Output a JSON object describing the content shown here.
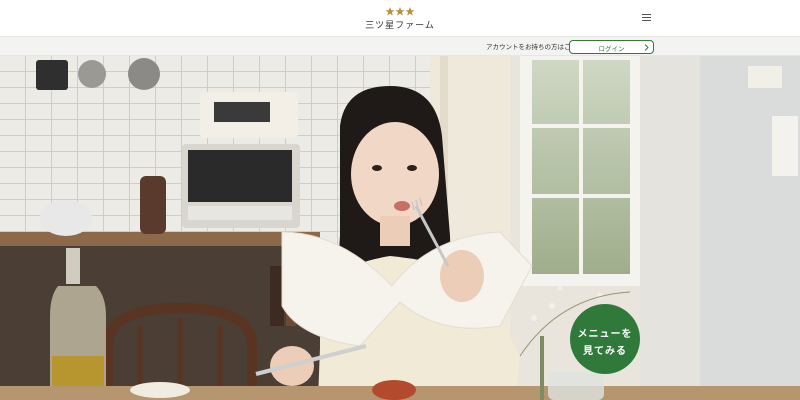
{
  "header": {
    "logo_text": "三ツ星ファーム",
    "logo_icon": "three-stars-icon",
    "menu_icon": "hamburger-menu-icon"
  },
  "account_bar": {
    "prompt": "アカウントをお持ちの方はこちら",
    "login_label": "ログイン",
    "login_icon": "chevron-right-icon"
  },
  "hero": {
    "cta_line1": "メニューを",
    "cta_line2": "見てみる"
  },
  "colors": {
    "brand_green": "#2f7a3b",
    "logo_gold": "#b8923a",
    "account_bar_bg": "#f3f3f1"
  }
}
